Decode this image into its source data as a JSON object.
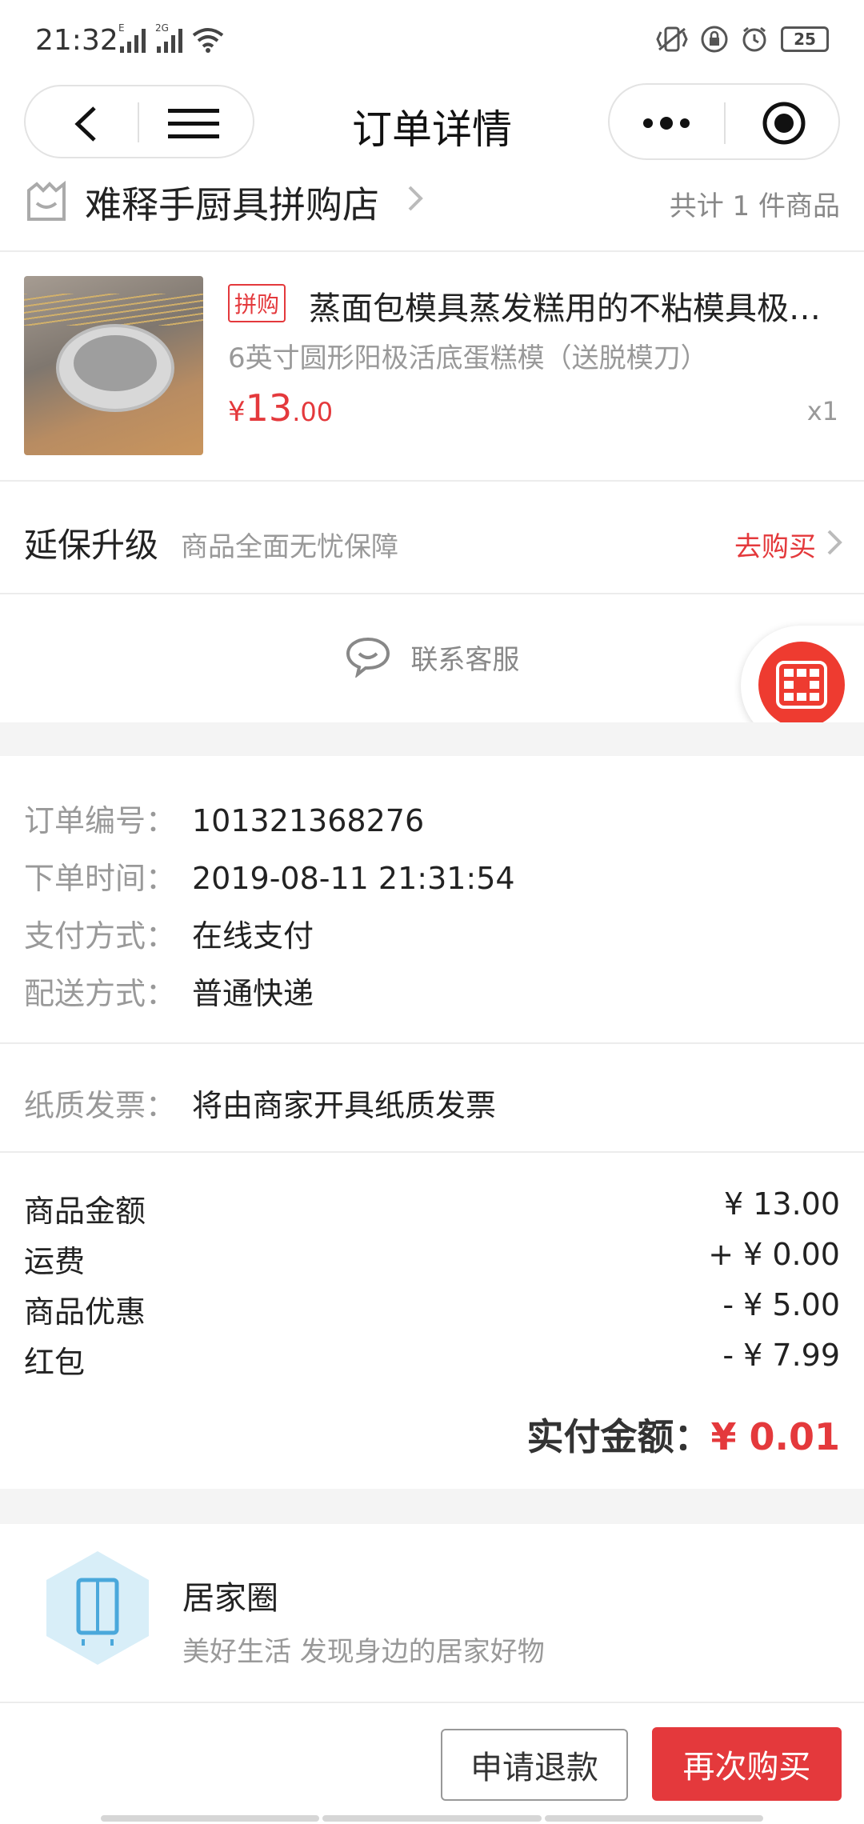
{
  "status_bar": {
    "time": "21:32",
    "network_tags": [
      "E",
      "2G"
    ],
    "battery": "25",
    "icons": [
      "signal-icon",
      "wifi-icon",
      "vibrate-icon",
      "lock-icon",
      "alarm-icon",
      "battery-icon"
    ]
  },
  "nav": {
    "title": "订单详情",
    "icons": [
      "back-icon",
      "menu-icon",
      "more-dots-icon",
      "target-icon"
    ]
  },
  "shop": {
    "name": "难释手厨具拼购店",
    "count_text": "共计 1 件商品"
  },
  "product": {
    "tag": "拼购",
    "title": "蒸面包模具蒸发糕用的不粘模具极…",
    "sku": "6英寸圆形阳极活底蛋糕模（送脱模刀）",
    "price_symbol": "¥",
    "price_int": "13",
    "price_dec": ".00",
    "quantity": "x1"
  },
  "warranty": {
    "title": "延保升级",
    "desc": "商品全面无忧保障",
    "action": "去购买"
  },
  "service": {
    "label": "联系客服"
  },
  "order_info": [
    {
      "key": "订单编号：",
      "value": "101321368276"
    },
    {
      "key": "下单时间：",
      "value": "2019-08-11 21:31:54"
    },
    {
      "key": "支付方式：",
      "value": "在线支付"
    },
    {
      "key": "配送方式：",
      "value": "普通快递"
    }
  ],
  "invoice": {
    "key": "纸质发票：",
    "value": "将由商家开具纸质发票"
  },
  "amounts": [
    {
      "label": "商品金额",
      "value": "¥ 13.00"
    },
    {
      "label": "运费",
      "value": "+ ¥ 0.00"
    },
    {
      "label": "商品优惠",
      "value": "- ¥ 5.00"
    },
    {
      "label": "红包",
      "value": "- ¥ 7.99"
    }
  ],
  "actual_paid": {
    "label": "实付金额：",
    "value": "¥ 0.01"
  },
  "home_card": {
    "title": "居家圈",
    "subtitle": "美好生活 发现身边的居家好物"
  },
  "bottom": {
    "refund_label": "申请退款",
    "rebuy_label": "再次购买"
  },
  "colors": {
    "accent_red": "#e4393c",
    "muted_text": "#999999",
    "divider": "#ececec",
    "band": "#f4f4f4"
  }
}
